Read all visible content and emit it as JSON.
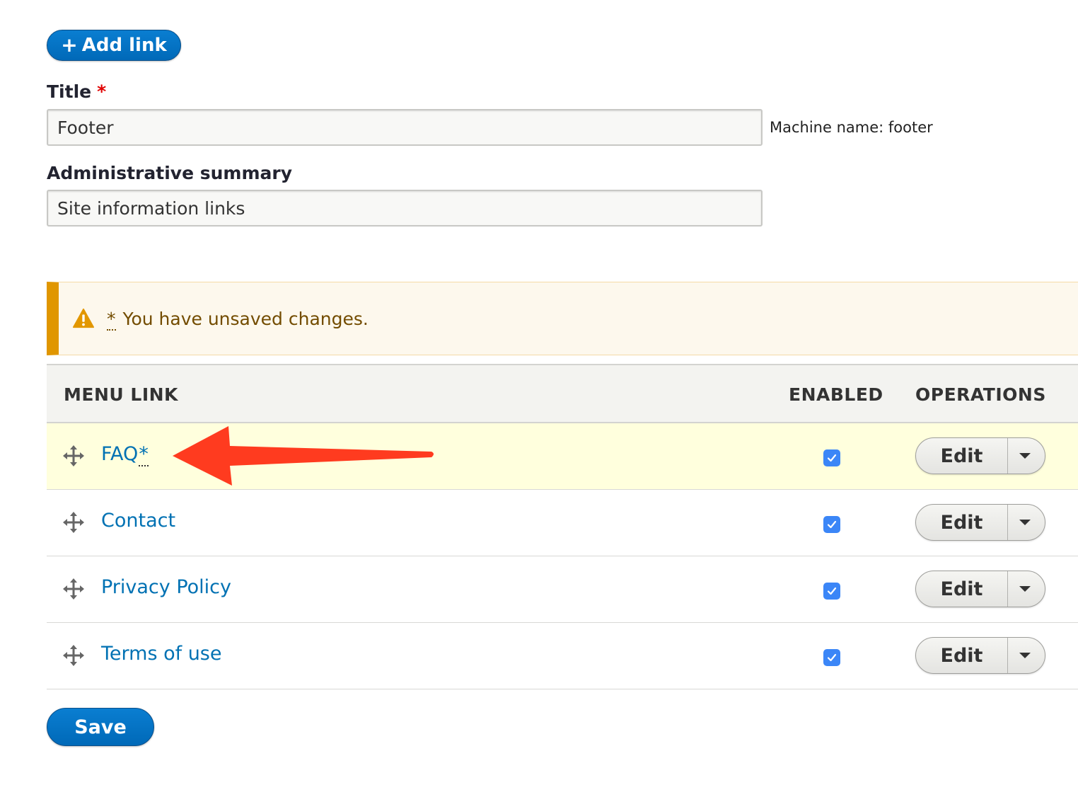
{
  "toolbar": {
    "add_link_label": "Add link",
    "add_link_icon": "plus-icon"
  },
  "form": {
    "title_label": "Title",
    "required_marker": "*",
    "title_value": "Footer",
    "machine_name": "Machine name: footer",
    "summary_label": "Administrative summary",
    "summary_value": "Site information links"
  },
  "warning": {
    "icon": "warning-icon",
    "marker": "*",
    "text": "You have unsaved changes.",
    "accent_color": "#e09600"
  },
  "table": {
    "headers": [
      "MENU LINK",
      "ENABLED",
      "OPERATIONS"
    ],
    "rows": [
      {
        "label": "FAQ",
        "changed_marker": "*",
        "enabled": true,
        "operation": "Edit"
      },
      {
        "label": "Contact",
        "enabled": true,
        "operation": "Edit"
      },
      {
        "label": "Privacy Policy",
        "enabled": true,
        "operation": "Edit"
      },
      {
        "label": "Terms of use",
        "enabled": true,
        "operation": "Edit"
      }
    ]
  },
  "actions": {
    "save_label": "Save"
  },
  "colors": {
    "primary": "#0071b3",
    "changed_row": "#ffffdd",
    "annotation_arrow": "#ff3b1f"
  }
}
